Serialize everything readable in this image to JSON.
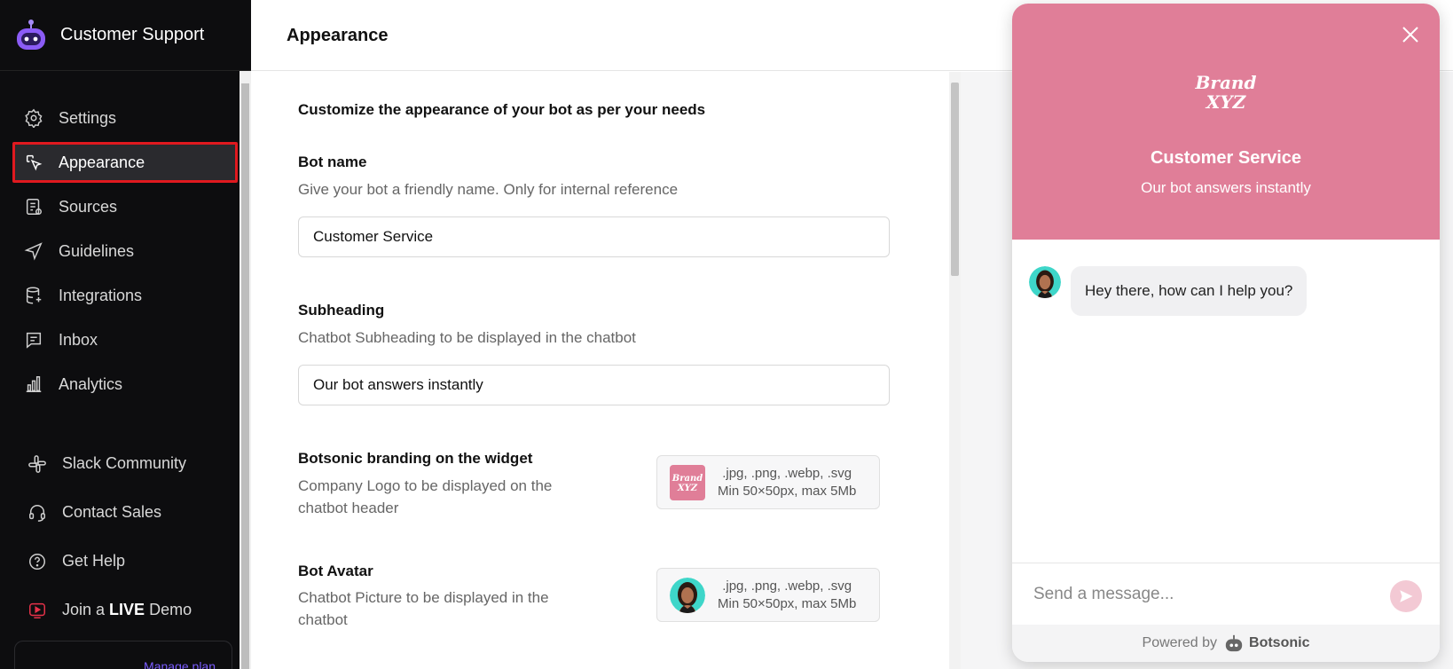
{
  "app": {
    "title": "Customer Support"
  },
  "sidebar": {
    "items": [
      {
        "label": "Settings",
        "icon": "gear-icon"
      },
      {
        "label": "Appearance",
        "icon": "cursor-click-icon",
        "active": true
      },
      {
        "label": "Sources",
        "icon": "document-list-icon"
      },
      {
        "label": "Guidelines",
        "icon": "send-arrow-icon"
      },
      {
        "label": "Integrations",
        "icon": "database-icon"
      },
      {
        "label": "Inbox",
        "icon": "message-icon"
      },
      {
        "label": "Analytics",
        "icon": "bar-chart-icon"
      }
    ],
    "secondary": [
      {
        "label": "Slack Community",
        "icon": "slack-icon"
      },
      {
        "label": "Contact Sales",
        "icon": "headset-icon"
      },
      {
        "label": "Get Help",
        "icon": "help-icon"
      },
      {
        "label_prefix": "Join a ",
        "label_bold": "LIVE",
        "label_suffix": " Demo",
        "icon": "live-video-icon"
      }
    ],
    "manage_plan": "Manage plan"
  },
  "header": {
    "title": "Appearance"
  },
  "main": {
    "intro": "Customize the appearance of your bot as per your needs",
    "bot_name": {
      "title": "Bot name",
      "description": "Give your bot a friendly name. Only for internal reference",
      "value": "Customer Service"
    },
    "subheading": {
      "title": "Subheading",
      "description": "Chatbot Subheading to be displayed in the chatbot",
      "value": "Our bot answers instantly"
    },
    "branding": {
      "title": "Botsonic branding on the widget",
      "description_line1": "Company Logo to be displayed on the",
      "description_line2": "chatbot header",
      "formats": ".jpg, .png, .webp, .svg",
      "size": "Min 50×50px, max 5Mb"
    },
    "avatar": {
      "title": "Bot Avatar",
      "description_line1": "Chatbot Picture to be displayed in the",
      "description_line2": "chatbot",
      "formats": ".jpg, .png, .webp, .svg",
      "size": "Min 50×50px, max 5Mb"
    }
  },
  "widget": {
    "logo_text_line1": "Brand",
    "logo_text_line2": "XYZ",
    "title": "Customer Service",
    "subtitle": "Our bot answers instantly",
    "message": "Hey there, how can I help you?",
    "placeholder": "Send a message...",
    "powered_by": "Powered by",
    "powered_name": "Botsonic",
    "header_color": "#e07e98"
  },
  "colors": {
    "sidebar_bg": "#0d0d0f",
    "active_outline": "#e0191f",
    "accent": "#7a5cff"
  }
}
